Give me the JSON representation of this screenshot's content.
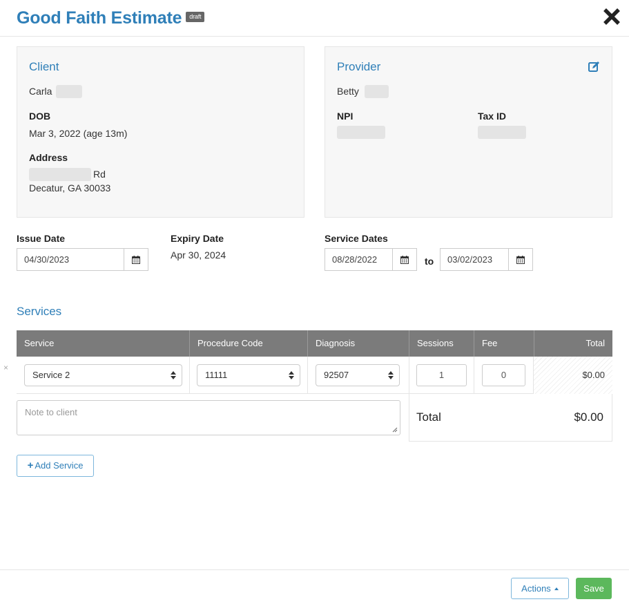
{
  "header": {
    "title": "Good Faith Estimate",
    "badge": "draft",
    "close_icon": "close-icon"
  },
  "client": {
    "title": "Client",
    "name": "Carla",
    "dob_label": "DOB",
    "dob_value": "Mar 3, 2022 (age 13m)",
    "address_label": "Address",
    "address_line1_suffix": "Rd",
    "address_line2": "Decatur, GA 30033"
  },
  "provider": {
    "title": "Provider",
    "name": "Betty",
    "npi_label": "NPI",
    "tax_id_label": "Tax ID",
    "edit_icon": "edit-icon"
  },
  "dates": {
    "issue_label": "Issue Date",
    "issue_value": "04/30/2023",
    "expiry_label": "Expiry Date",
    "expiry_value": "Apr 30, 2024",
    "service_label": "Service Dates",
    "service_start": "08/28/2022",
    "to_label": "to",
    "service_end": "03/02/2023"
  },
  "services": {
    "title": "Services",
    "columns": [
      "Service",
      "Procedure Code",
      "Diagnosis",
      "Sessions",
      "Fee",
      "Total"
    ],
    "rows": [
      {
        "service": "Service 2",
        "procedure_code": "11111",
        "diagnosis": "92507",
        "sessions": "1",
        "fee": "0",
        "total": "$0.00"
      }
    ],
    "remove_icon": "×",
    "note_placeholder": "Note to client",
    "total_label": "Total",
    "total_value": "$0.00",
    "add_label": "Add Service"
  },
  "footer": {
    "actions_label": "Actions",
    "save_label": "Save"
  },
  "colors": {
    "accent": "#2f7fb8",
    "save": "#5cb85c",
    "table_header": "#7b7b7b",
    "card_bg": "#f7f7f7"
  }
}
